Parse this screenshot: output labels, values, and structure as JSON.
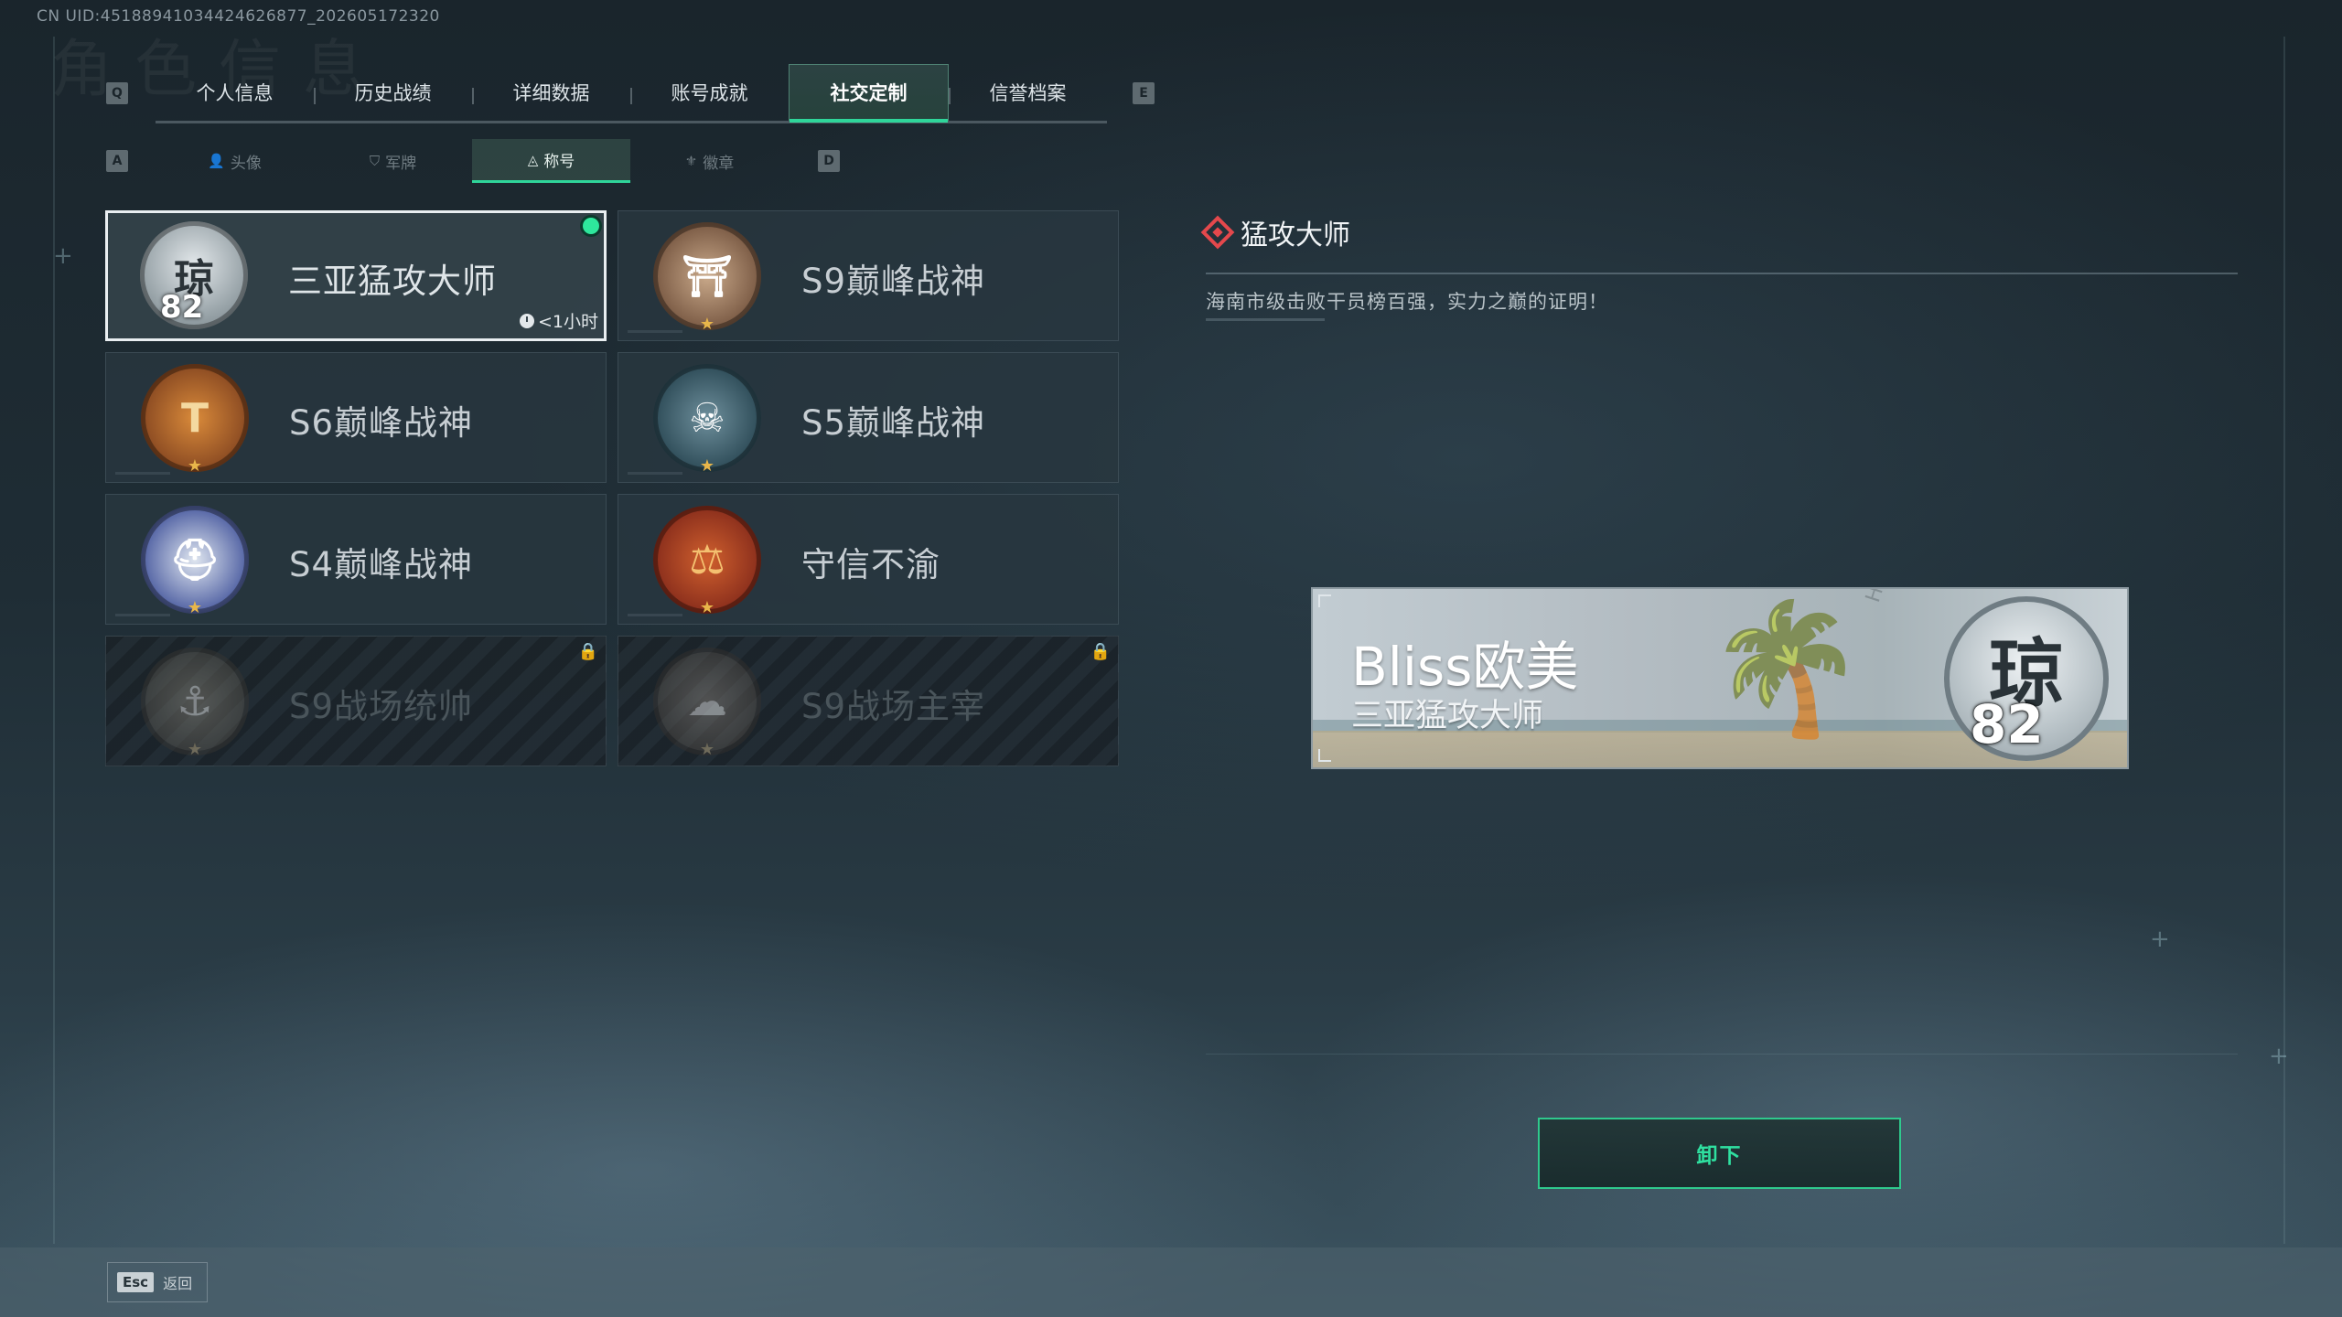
{
  "uid_text": "CN UID:4518894103442462687​7_202605172320",
  "bg_title": "角色信息",
  "keys": {
    "prev_tab": "Q",
    "next_tab": "E",
    "prev_sub": "A",
    "next_sub": "D"
  },
  "tabs": [
    {
      "label": "个人信息"
    },
    {
      "label": "历史战绩"
    },
    {
      "label": "详细数据"
    },
    {
      "label": "账号成就"
    },
    {
      "label": "社交定制",
      "active": true
    },
    {
      "label": "信誉档案"
    }
  ],
  "subtabs": [
    {
      "label": "头像",
      "icon": "person-icon"
    },
    {
      "label": "军牌",
      "icon": "dogtag-icon"
    },
    {
      "label": "称号",
      "icon": "title-icon",
      "active": true
    },
    {
      "label": "徽章",
      "icon": "badge-icon"
    }
  ],
  "titles": [
    {
      "name": "三亚猛攻大师",
      "emblem_char": "琼",
      "emblem_num": "82",
      "selected": true,
      "equipped": true,
      "time": "<1小时",
      "color": "#9aa5aa"
    },
    {
      "name": "S9巅峰战神",
      "emblem_char": "⛩",
      "color": "#7a5a44"
    },
    {
      "name": "S6巅峰战神",
      "emblem_char": "T",
      "color": "#8a4a22"
    },
    {
      "name": "S5巅峰战神",
      "emblem_char": "☠",
      "color": "#2e4c58"
    },
    {
      "name": "S4巅峰战神",
      "emblem_char": "⛑",
      "color": "#2a3a7a"
    },
    {
      "name": "守信不渝",
      "emblem_char": "⚖",
      "color": "#8a2e1c"
    },
    {
      "name": "S9战场统帅",
      "emblem_char": "⚓",
      "color": "#5b5443",
      "locked": true
    },
    {
      "name": "S9战场主宰",
      "emblem_char": "☁",
      "color": "#5b4a3e",
      "locked": true
    }
  ],
  "detail": {
    "title": "猛攻大师",
    "description": "海南市级击败干员榜百强，实力之巅的证明！"
  },
  "preview": {
    "player_name": "Bliss欧美",
    "player_title": "三亚猛攻大师",
    "vertical_text": "HAINAN HA",
    "emblem_char": "琼",
    "emblem_num": "82"
  },
  "unequip_button": "卸下",
  "esc_key": "Esc",
  "back_label": "返回",
  "colors": {
    "accent": "#2fd59a",
    "danger": "#e4484c"
  }
}
